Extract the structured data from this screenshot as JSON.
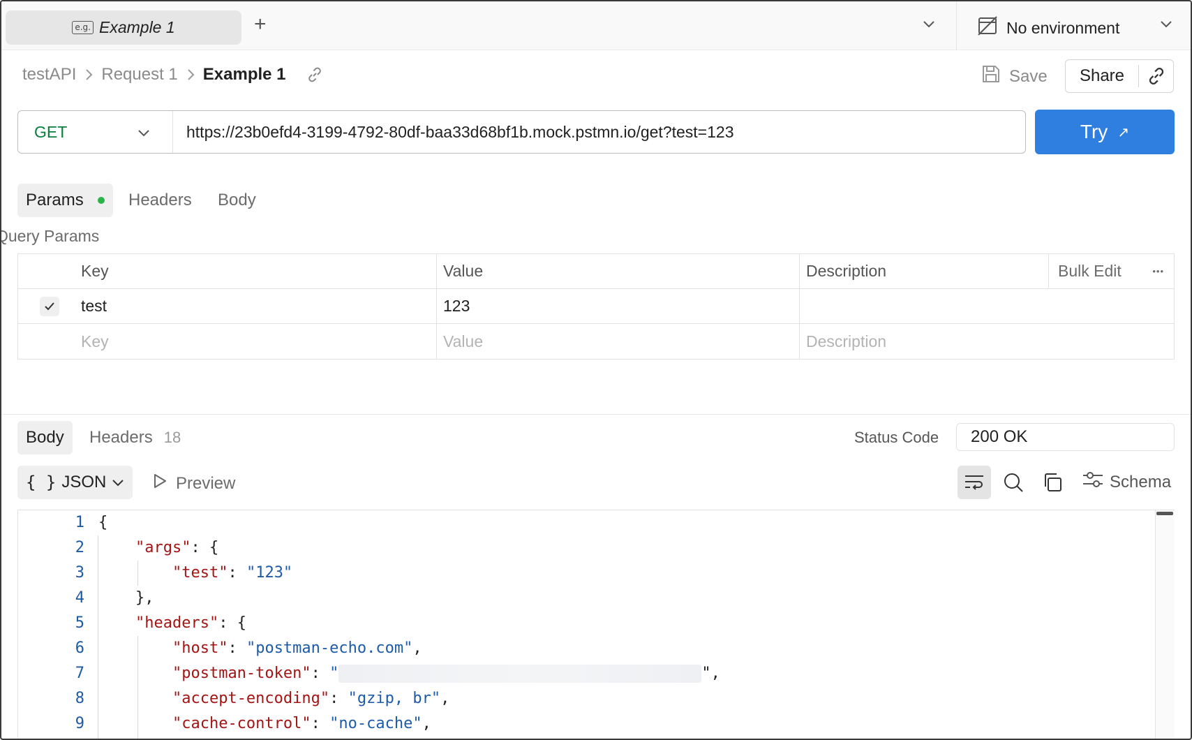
{
  "tabbar": {
    "tab_badge": "e.g.",
    "tab_label": "Example 1",
    "new_tab": "+",
    "environment": "No environment"
  },
  "breadcrumb": {
    "items": [
      "testAPI",
      "Request 1",
      "Example 1"
    ]
  },
  "actions": {
    "save_label": "Save",
    "share_label": "Share"
  },
  "request": {
    "method": "GET",
    "url": "https://23b0efd4-3199-4792-80df-baa33d68bf1b.mock.pstmn.io/get?test=123",
    "try_label": "Try",
    "try_icon": "↗"
  },
  "request_tabs": [
    "Params",
    "Headers",
    "Body"
  ],
  "query_params": {
    "title": "Query Params",
    "headers": {
      "key": "Key",
      "value": "Value",
      "description": "Description",
      "bulk_edit": "Bulk Edit",
      "more": "•••"
    },
    "rows": [
      {
        "checked": true,
        "key": "test",
        "value": "123",
        "description": ""
      }
    ],
    "placeholder": {
      "key": "Key",
      "value": "Value",
      "description": "Description"
    }
  },
  "response": {
    "tabs": {
      "body": "Body",
      "headers": "Headers",
      "headers_count": "18"
    },
    "status_label": "Status Code",
    "status_value": "200 OK",
    "format_braces": "{ }",
    "format": "JSON",
    "preview": "Preview",
    "schema": "Schema"
  },
  "code": {
    "line_numbers": [
      "1",
      "2",
      "3",
      "4",
      "5",
      "6",
      "7",
      "8",
      "9"
    ],
    "lines": [
      {
        "indent": "",
        "key": "",
        "punct_pre": "{",
        "val": "",
        "punct_post": ""
      },
      {
        "indent": "    ",
        "key": "\"args\"",
        "punct_pre": ": {",
        "val": "",
        "punct_post": ""
      },
      {
        "indent": "        ",
        "key": "\"test\"",
        "punct_pre": ": ",
        "val": "\"123\"",
        "punct_post": ""
      },
      {
        "indent": "    ",
        "key": "",
        "punct_pre": "},",
        "val": "",
        "punct_post": ""
      },
      {
        "indent": "    ",
        "key": "\"headers\"",
        "punct_pre": ": {",
        "val": "",
        "punct_post": ""
      },
      {
        "indent": "        ",
        "key": "\"host\"",
        "punct_pre": ": ",
        "val": "\"postman-echo.com\"",
        "punct_post": ","
      },
      {
        "indent": "        ",
        "key": "\"postman-token\"",
        "punct_pre": ": ",
        "val": "\"",
        "punct_post": "\","
      },
      {
        "indent": "        ",
        "key": "\"accept-encoding\"",
        "punct_pre": ": ",
        "val": "\"gzip, br\"",
        "punct_post": ","
      },
      {
        "indent": "        ",
        "key": "\"cache-control\"",
        "punct_pre": ": ",
        "val": "\"no-cache\"",
        "punct_post": ","
      }
    ]
  },
  "colors": {
    "accent": "#2f7fe0",
    "method_get": "#0a7d3b",
    "json_key": "#a31515",
    "json_string": "#1d5ba8",
    "status_dot": "#2bb34b"
  }
}
